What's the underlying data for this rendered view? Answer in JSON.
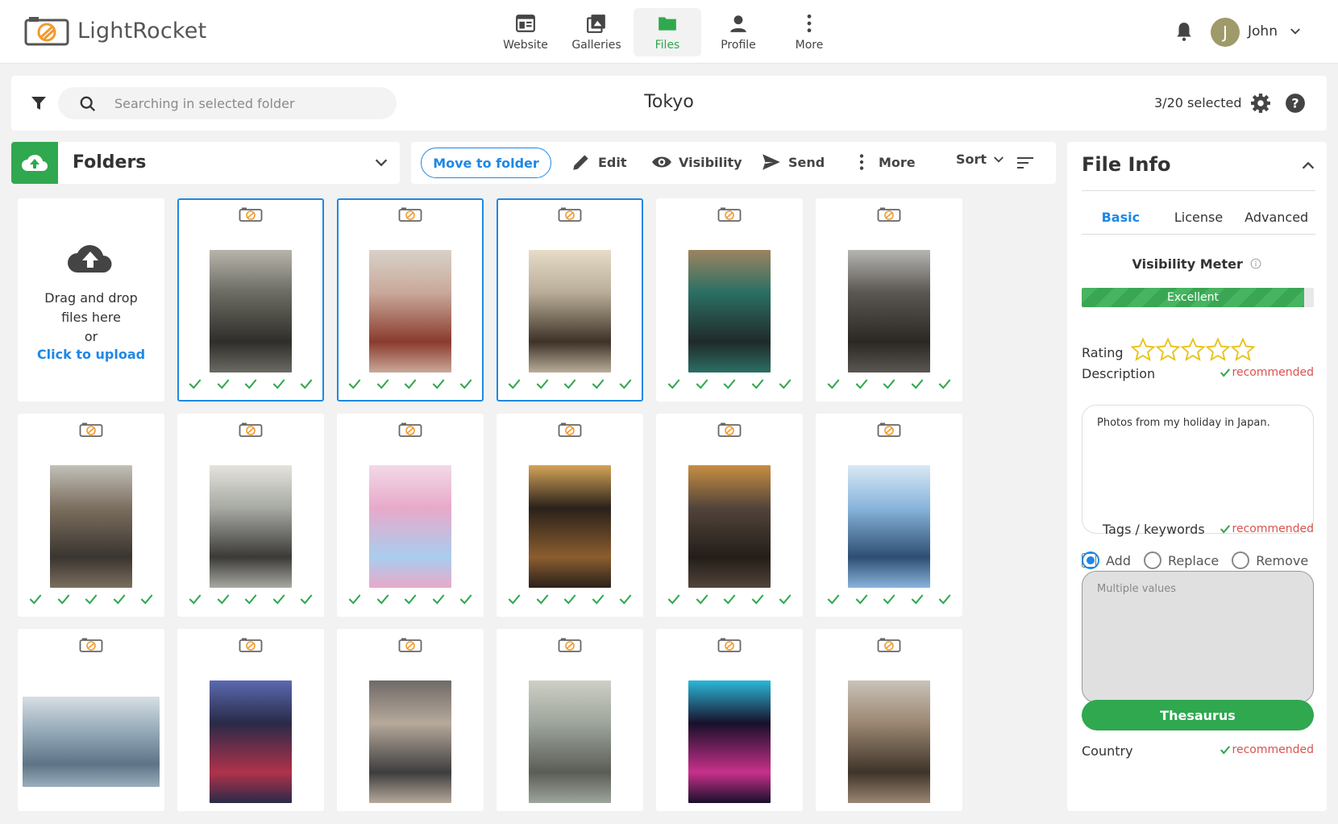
{
  "app": {
    "name": "LightRocket"
  },
  "nav": [
    {
      "label": "Website",
      "icon": "website-icon"
    },
    {
      "label": "Galleries",
      "icon": "galleries-icon"
    },
    {
      "label": "Files",
      "icon": "folder-icon",
      "active": true
    },
    {
      "label": "Profile",
      "icon": "profile-icon"
    },
    {
      "label": "More",
      "icon": "more-vertical-icon"
    }
  ],
  "user": {
    "initial": "J",
    "name": "John"
  },
  "search": {
    "placeholder": "Searching in selected folder",
    "value": ""
  },
  "folder": {
    "title": "Tokyo"
  },
  "selection": {
    "text": "3/20 selected"
  },
  "folders_panel": {
    "label": "Folders"
  },
  "toolbar": {
    "move": "Move to folder",
    "edit": "Edit",
    "visibility": "Visibility",
    "send": "Send",
    "more": "More",
    "sort": "Sort"
  },
  "upload": {
    "line1": "Drag and drop",
    "line2": "files here",
    "line3": "or",
    "click": "Click to upload"
  },
  "photos": [
    {
      "selected": true,
      "tone": [
        "#6b6b63",
        "#2f2e2a",
        "#b8b4ab"
      ],
      "orientation": "portrait"
    },
    {
      "selected": true,
      "tone": [
        "#c9a89a",
        "#8a3b2e",
        "#d8d2c8"
      ],
      "orientation": "portrait"
    },
    {
      "selected": true,
      "tone": [
        "#b9ad98",
        "#3e3228",
        "#e6dcc8"
      ],
      "orientation": "portrait"
    },
    {
      "selected": false,
      "tone": [
        "#2a6f63",
        "#202a2a",
        "#9c8460"
      ],
      "orientation": "portrait"
    },
    {
      "selected": false,
      "tone": [
        "#5a5651",
        "#2b2824",
        "#b5b5b2"
      ],
      "orientation": "portrait"
    },
    {
      "selected": false,
      "tone": [
        "#7b6e5e",
        "#3a3530",
        "#c2c0b9"
      ],
      "orientation": "portrait"
    },
    {
      "selected": false,
      "tone": [
        "#a7a9a3",
        "#3c3a37",
        "#e6e3dd"
      ],
      "orientation": "portrait"
    },
    {
      "selected": false,
      "tone": [
        "#e8a9c9",
        "#a9cdef",
        "#f2d9e7"
      ],
      "orientation": "portrait"
    },
    {
      "selected": false,
      "tone": [
        "#2a211b",
        "#8b5d2e",
        "#d4a458"
      ],
      "orientation": "portrait"
    },
    {
      "selected": false,
      "tone": [
        "#52443a",
        "#231d19",
        "#c78e42"
      ],
      "orientation": "portrait"
    },
    {
      "selected": false,
      "tone": [
        "#88b4dc",
        "#2e4e72",
        "#d8e8f4"
      ],
      "orientation": "portrait"
    },
    {
      "selected": false,
      "tone": [
        "#9aaebc",
        "#5e7486",
        "#d7dfe5"
      ],
      "orientation": "landscape"
    },
    {
      "selected": false,
      "tone": [
        "#2a2a48",
        "#b0324a",
        "#5a6ab0"
      ],
      "orientation": "portrait"
    },
    {
      "selected": false,
      "tone": [
        "#b6a99b",
        "#3e3d3e",
        "#6f6a66"
      ],
      "orientation": "portrait"
    },
    {
      "selected": false,
      "tone": [
        "#9da59c",
        "#5a5d55",
        "#cfcfc6"
      ],
      "orientation": "portrait"
    },
    {
      "selected": false,
      "tone": [
        "#18102a",
        "#c8308a",
        "#2ab8d8"
      ],
      "orientation": "portrait"
    },
    {
      "selected": false,
      "tone": [
        "#9b8672",
        "#3e3429",
        "#c9c3b8"
      ],
      "orientation": "portrait"
    }
  ],
  "file_info": {
    "title": "File Info",
    "tabs": [
      "Basic",
      "License",
      "Advanced"
    ],
    "active_tab": "Basic",
    "visibility_meter": {
      "label": "Visibility Meter",
      "level_text": "Excellent",
      "level": 0.96
    },
    "rating": {
      "label": "Rating",
      "value": 0,
      "max": 5
    },
    "description": {
      "label": "Description",
      "value": "Photos from my holiday in Japan."
    },
    "recommended": "recommended",
    "tags": {
      "label": "Tags / keywords",
      "checked": false,
      "placeholder": "Multiple values"
    },
    "tag_modes": [
      "Add",
      "Replace",
      "Remove"
    ],
    "tag_mode_selected": "Add",
    "thesaurus": "Thesaurus",
    "country": {
      "label": "Country"
    }
  },
  "colors": {
    "brand_green": "#2fa84f",
    "accent_blue": "#1e88e5",
    "recommended_red": "#d9534f",
    "star_yellow": "#e8c21a"
  }
}
